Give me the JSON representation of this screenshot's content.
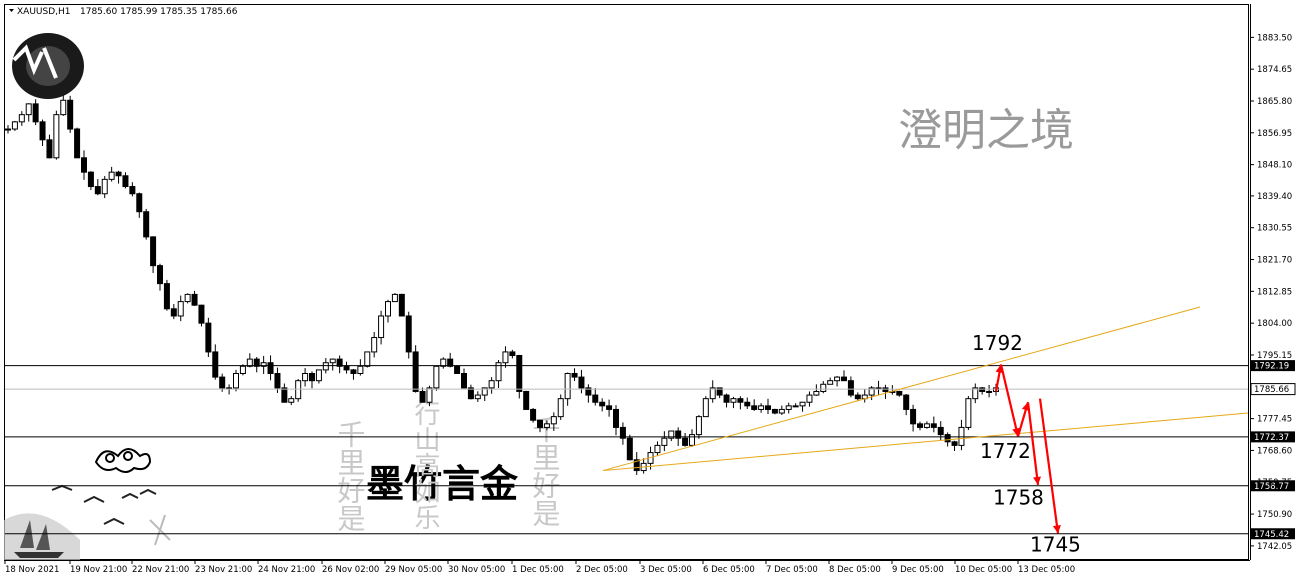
{
  "header": {
    "symbol": "XAUUSD",
    "timeframe": "H1",
    "ohlc": "1785.60 1785.99 1785.35 1785.66"
  },
  "watermarks": {
    "title_top_right": "澄明之境",
    "title_center": "墨竹言金",
    "calligraphy_left": "千里好是",
    "calligraphy_mid": "行山高如乐",
    "calligraphy_right": "千里好是"
  },
  "colors": {
    "background": "#ffffff",
    "candle": "#000000",
    "trendline": "#e6a817",
    "arrow": "#ff0000",
    "hline": "#000000",
    "price_tag_bg": "#000000",
    "price_tag_text": "#ffffff"
  },
  "chart_data": {
    "type": "candlestick",
    "title": "XAUUSD,H1",
    "ylim": [
      1738.4,
      1892.5
    ],
    "y_ticks": [
      1883.5,
      1874.65,
      1865.8,
      1856.95,
      1848.1,
      1839.4,
      1830.55,
      1821.7,
      1812.85,
      1804.0,
      1795.15,
      1777.45,
      1768.6,
      1759.75,
      1750.9,
      1742.05
    ],
    "x_ticks": [
      "18 Nov 2021",
      "19 Nov 21:00",
      "22 Nov 21:00",
      "23 Nov 21:00",
      "24 Nov 21:00",
      "26 Nov 02:00",
      "29 Nov 05:00",
      "30 Nov 05:00",
      "1 Dec 05:00",
      "2 Dec 05:00",
      "3 Dec 05:00",
      "6 Dec 05:00",
      "7 Dec 05:00",
      "8 Dec 05:00",
      "9 Dec 05:00",
      "10 Dec 05:00",
      "13 Dec 05:00"
    ],
    "current_price": 1785.66,
    "horizontal_levels": [
      1792.19,
      1772.37,
      1758.77,
      1745.42
    ],
    "targets": [
      "1792",
      "1772",
      "1758",
      "1745"
    ],
    "series": [
      {
        "name": "XAUUSD",
        "values": [
          1858,
          1860,
          1862,
          1865,
          1860,
          1855,
          1850,
          1862,
          1866,
          1858,
          1850,
          1846,
          1842,
          1840,
          1844,
          1846,
          1845,
          1842,
          1840,
          1835,
          1828,
          1820,
          1815,
          1808,
          1806,
          1810,
          1812,
          1809,
          1804,
          1796,
          1789,
          1786,
          1786,
          1790,
          1792,
          1794,
          1792,
          1793,
          1790,
          1786,
          1782,
          1783,
          1788,
          1790,
          1788,
          1791,
          1793,
          1794,
          1792,
          1791,
          1790,
          1792,
          1796,
          1800,
          1806,
          1810,
          1812,
          1806,
          1796,
          1785,
          1782,
          1786,
          1792,
          1794,
          1792,
          1790,
          1786,
          1783,
          1784,
          1786,
          1788,
          1793,
          1796,
          1795,
          1785,
          1780,
          1777,
          1775,
          1776,
          1778,
          1783,
          1790,
          1789,
          1786,
          1784,
          1782,
          1781,
          1780,
          1775,
          1772,
          1766,
          1763,
          1765,
          1768,
          1770,
          1772,
          1774,
          1772,
          1770,
          1773,
          1778,
          1783,
          1786,
          1784,
          1782,
          1783,
          1782,
          1781,
          1780,
          1781,
          1780,
          1779,
          1780,
          1781,
          1781,
          1782,
          1784,
          1785,
          1787,
          1788,
          1789,
          1788,
          1784,
          1783,
          1784,
          1786,
          1786,
          1785,
          1785,
          1784,
          1780,
          1776,
          1775,
          1776,
          1775,
          1773,
          1771,
          1770,
          1775,
          1783,
          1786,
          1785,
          1785,
          1786
        ]
      }
    ]
  }
}
